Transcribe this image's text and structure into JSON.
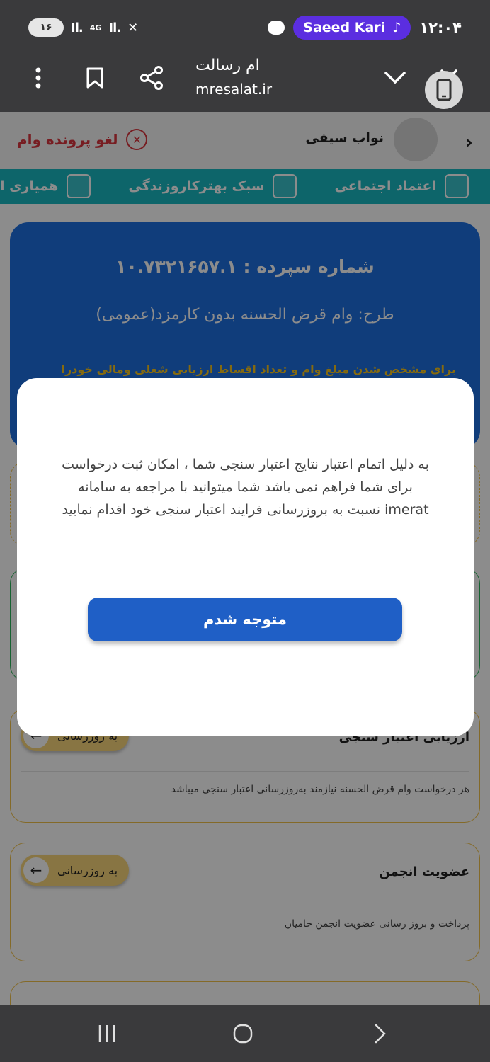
{
  "status_bar": {
    "battery": "۱۶",
    "network": "4G",
    "contact_pill": "Saeed Kari",
    "time": "۱۲:۰۴"
  },
  "browser": {
    "title": "ام رسالت",
    "url": "mresalat.ir"
  },
  "header": {
    "user_name": "نواب سیفی",
    "cancel_label": "لغو پرونده وام"
  },
  "tabs": [
    "اعتماد اجتماعی",
    "سبک بهترکاروزندگی",
    "همیاری ا"
  ],
  "loan_card": {
    "deposit_number": "شماره سپرده :  ۱۰.۷۳۲۱۶۵۷.۱",
    "plan": "طرح:  وام قرض الحسنه بدون کارمزد(عمومی)",
    "note": "برای مشخص شدن مبلغ وام و تعداد اقساط ارزیابی شغلی ومالی خودرا"
  },
  "cards": [
    {
      "title": "ارزیابی اعتبار سنجی",
      "button": "به روزرسانی",
      "description": "هر درخواست وام قرض الحسنه نیازمند به‌روزرسانی اعتبار سنجی میباشد"
    },
    {
      "title": "عضویت انجمن",
      "button": "به روزرسانی",
      "description": "پرداخت و بروز رسانی عضویت انجمن حامیان"
    }
  ],
  "modal": {
    "message": "به دلیل اتمام اعتبار نتایج اعتبار سنجی شما ، امکان ثبت درخواست برای شما فراهم نمی باشد شما میتوانید با مراجعه به سامانه imerat نسبت به بروزرسانی فرایند اعتبار سنجی خود اقدام نمایید",
    "button": "متوجه شدم"
  },
  "icons": {
    "menu": "more-vert-icon",
    "bookmark": "bookmark-icon",
    "share": "share-icon",
    "expand": "chevron-down-icon",
    "close": "close-icon",
    "rotate": "rotate-screen-icon"
  },
  "colors": {
    "primary_blue": "#1e6fe0",
    "modal_button": "#1f5fc6",
    "tab_bar": "#18b8c2",
    "cancel_red": "#d9363e",
    "pill_purple": "#5b2ee0",
    "accent_yellow": "#f7d57a"
  }
}
